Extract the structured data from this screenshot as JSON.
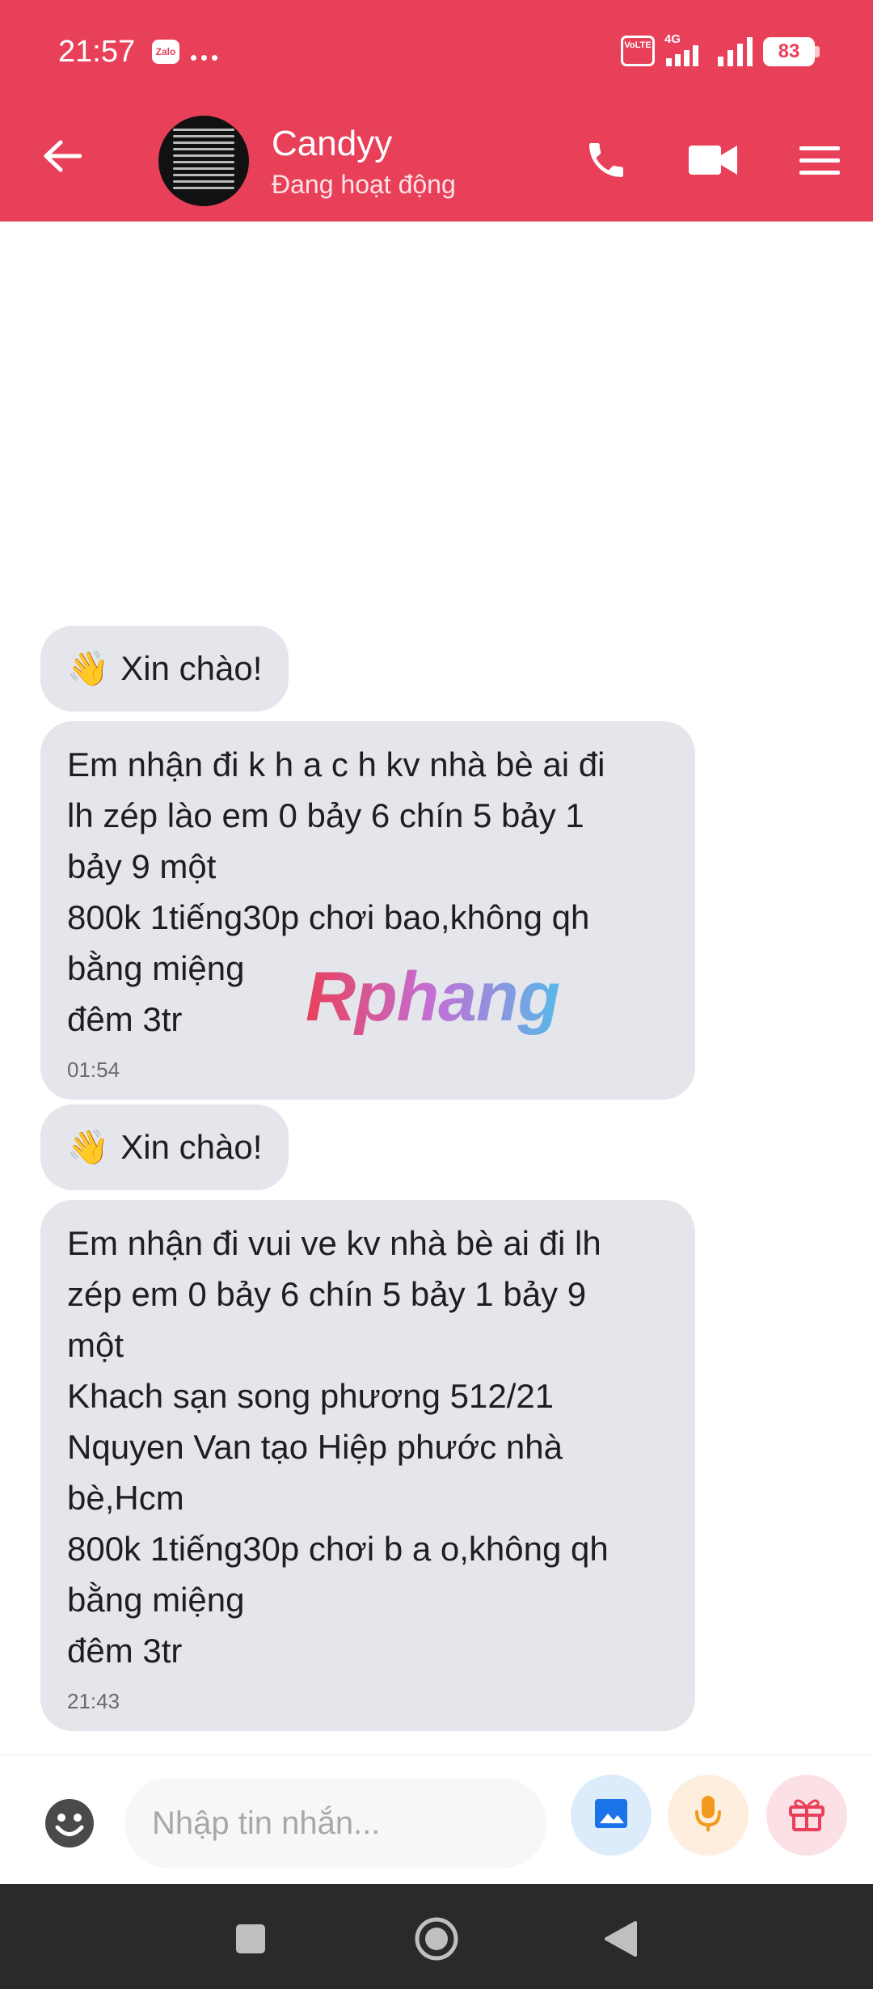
{
  "status_bar": {
    "time": "21:57",
    "app_badge": "Zalo",
    "volte_label": "VoLTE",
    "network_label": "4G",
    "battery": "83"
  },
  "header": {
    "contact_name": "Candyy",
    "contact_status": "Đang hoạt động",
    "accent_color": "#e9405a"
  },
  "messages": [
    {
      "type": "greeting",
      "emoji": "👋",
      "text": "Xin chào!"
    },
    {
      "type": "text",
      "lines": [
        "Em nhận đi k h a c h kv nhà bè ai đi",
        "lh zép lào em 0 bảy 6 chín 5 bảy 1",
        "bảy 9 một",
        "800k 1tiếng30p chơi bao,không qh",
        "bằng miệng",
        "đêm 3tr"
      ],
      "time": "01:54"
    },
    {
      "type": "greeting",
      "emoji": "👋",
      "text": "Xin chào!"
    },
    {
      "type": "text",
      "lines": [
        "Em nhận đi vui ve kv nhà bè ai đi lh",
        "zép em 0 bảy 6 chín 5 bảy 1 bảy 9",
        "một",
        "Khach sạn song phương  512/21",
        "Nquyen Van tạo Hiệp phước nhà",
        "bè,Hcm",
        "800k 1tiếng30p chơi b a o,không qh",
        "bằng miệng",
        "đêm 3tr"
      ],
      "time": "21:43"
    }
  ],
  "watermark": "Rphang",
  "input": {
    "placeholder": "Nhập tin nhắn...",
    "value": ""
  },
  "icons": {
    "back": "arrow-left-icon",
    "call": "phone-icon",
    "video": "video-camera-icon",
    "menu": "hamburger-menu-icon",
    "emoji": "smiley-icon",
    "image": "image-icon",
    "mic": "microphone-icon",
    "gift": "gift-icon"
  },
  "colors": {
    "header_bg": "#e9405a",
    "bubble_bg": "#e4e6eb",
    "image_button_bg": "#dcecfb",
    "mic_button_bg": "#fdeedd",
    "gift_button_bg": "#fbe1e6",
    "nav_bar_bg": "#2a2a2a"
  }
}
